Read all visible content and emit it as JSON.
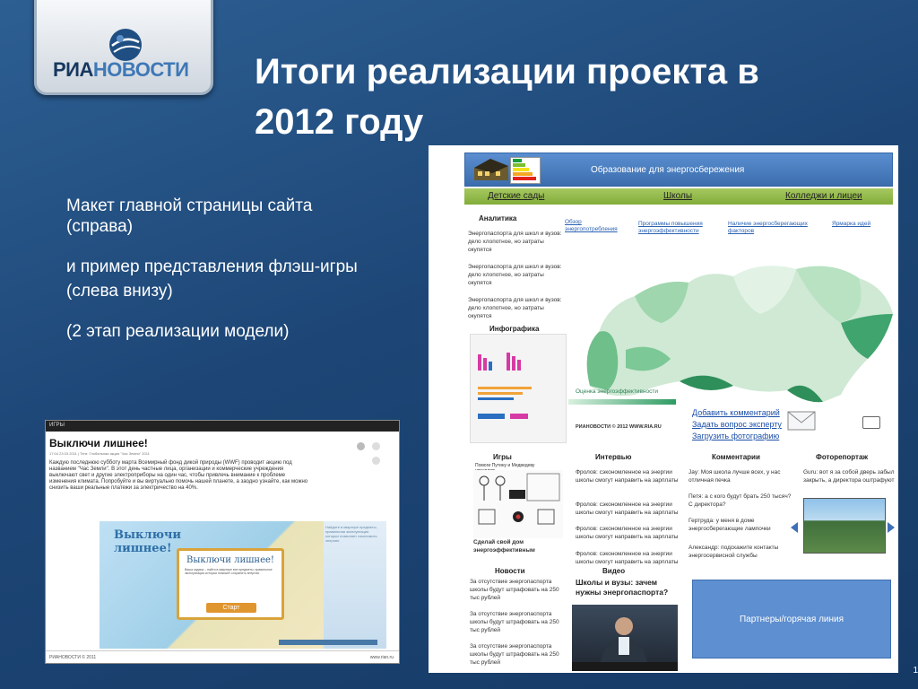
{
  "logo": {
    "part1": "РИА",
    "part2": "НОВОСТИ"
  },
  "title": "Итоги реализации проекта  в\n2012 году",
  "body": {
    "p1": "Макет главной страницы сайта (справа)",
    "p2": "и пример представления флэш-игры",
    "p3": "(слева внизу)",
    "p4": "(2 этап реализации модели)"
  },
  "game": {
    "top_label": "ИГРЫ",
    "heading": "Выключи лишнее!",
    "meta": "17:04 23.03.2011 | Теги: Глобальная акция \"Час Земли\" 2011",
    "desc": "Каждую последнюю субботу марта Всемирный фонд дикой природы (WWF) проводит акцию под названием \"Час Земли\". В этот день частные лица, организации и коммерческие учреждения выключают свет и другие электроприборы на один час, чтобы привлечь внимание к проблеме изменения климата. Попробуйте и вы виртуально помочь нашей планете, а заодно узнайте, как можно снизить ваши реальные платежи за электричество на 40%.",
    "stage_logo": "Выключи\nлишнее!",
    "dialog_title": "Выключи лишнее!",
    "dialog_text": "Ваша задача – найти в квартире все предметы, правильное эксплуатация которых поможет сохранить энергию.",
    "start_label": "Старт",
    "side_text": "Найдите в квартире предметы, правильная эксплуатация которых позволяет сэкономить энергию",
    "footer_left": "РИАНОВОСТИ © 2011",
    "footer_right": "www.rian.ru"
  },
  "site": {
    "banner_title": "Образование для энергосбережения",
    "nav": [
      "Детские сады",
      "Школы",
      "Колледжи и лицеи"
    ],
    "analytics_heading": "Аналитика",
    "analytics_items": [
      "Энергопаспорта для школ и вузов: дело хлопотное, но затраты окупятся",
      "Энергопаспорта для школ и вузов: дело хлопотное, но затраты окупятся",
      "Энергопаспорта для школ и вузов: дело хлопотное, но затраты окупятся"
    ],
    "top_links": [
      "Обзор энергопотребления",
      "Программы повышения энергоэффективности",
      "Наличие энергосберегающих факторов",
      "Ярмарка идей"
    ],
    "infographic_heading": "Инфографика",
    "legend_label": "Оценка энергоэффективности",
    "ria_mark": "РИАНОВОСТИ © 2012 WWW.RIA.RU",
    "actions": [
      "Добавить комментарий",
      "Задать вопрос эксперту",
      "Загрузить фотографию"
    ],
    "columns": {
      "games": "Игры",
      "interview": "Интервью",
      "comments": "Комментарии",
      "photo": "Фоторепортаж"
    },
    "interview_items": [
      "Фролов: сэкономленное на энергии школы смогут направить на зарплаты",
      "Фролов: сэкономленное на энергии школы смогут направить на зарплаты",
      "Фролов: сэкономленное на энергии школы смогут направить на зарплаты",
      "Фролов: сэкономленное на энергии школы смогут направить на зарплаты"
    ],
    "comments_items": [
      "Jay: Моя школа лучше всех, у нас отличная печка",
      "Петя: а с кого будут брать 250 тысяч? С директора?",
      "Гертруда: у меня в доме энергосберегающие лампочки",
      "Александр: подскажите контакты энергосервисной службы"
    ],
    "photo_caption": "Guru: вот я за собой дверь забыл закрыть, а директора оштрафуют",
    "game_caption": "Сделай свой дом энергоэффективным",
    "game_thumb_title": "Помоги Путину и Медведеву управлять",
    "news_heading": "Новости",
    "news_items": [
      "За отсутствие энергопаспорта школы будут штрафовать на 250 тыс рублей",
      "За отсутствие энергопаспорта школы будут штрафовать на 250 тыс рублей",
      "За отсутствие энергопаспорта школы будут штрафовать на 250 тыс рублей"
    ],
    "video_heading": "Видео",
    "video_title": "Школы и вузы: зачем нужны энергопаспорта?",
    "partners": "Партнеры/горячая линия"
  },
  "page_number": "1"
}
